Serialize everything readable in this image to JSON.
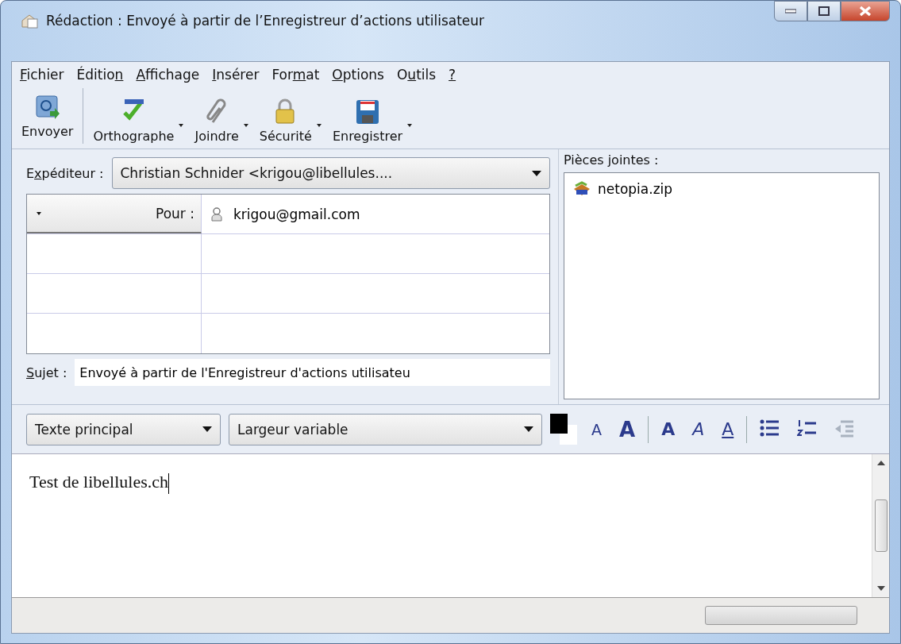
{
  "window": {
    "title": "Rédaction : Envoyé à partir de l’Enregistreur d’actions utilisateur"
  },
  "menu": [
    {
      "label": [
        {
          "text": "F",
          "underline": true
        },
        {
          "text": "ichier",
          "underline": false
        }
      ]
    },
    {
      "label": [
        {
          "text": "Éditio",
          "underline": false
        },
        {
          "text": "n",
          "underline": true
        }
      ]
    },
    {
      "label": [
        {
          "text": "A",
          "underline": true
        },
        {
          "text": "ffichage",
          "underline": false
        }
      ]
    },
    {
      "label": [
        {
          "text": "I",
          "underline": true
        },
        {
          "text": "nsérer",
          "underline": false
        }
      ]
    },
    {
      "label": [
        {
          "text": "For",
          "underline": false
        },
        {
          "text": "m",
          "underline": true
        },
        {
          "text": "at",
          "underline": false
        }
      ]
    },
    {
      "label": [
        {
          "text": "O",
          "underline": true
        },
        {
          "text": "ptions",
          "underline": false
        }
      ]
    },
    {
      "label": [
        {
          "text": "O",
          "underline": false
        },
        {
          "text": "u",
          "underline": true
        },
        {
          "text": "tils",
          "underline": false
        }
      ]
    },
    {
      "label": [
        {
          "text": "?",
          "underline": true
        }
      ]
    }
  ],
  "toolbar": [
    {
      "kind": "send",
      "label": "Envoyer",
      "dropdown": false
    },
    {
      "kind": "spell",
      "label": "Orthographe",
      "dropdown": true
    },
    {
      "kind": "attach",
      "label": "Joindre",
      "dropdown": true
    },
    {
      "kind": "security",
      "label": "Sécurité",
      "dropdown": true
    },
    {
      "kind": "save",
      "label": "Enregistrer",
      "dropdown": true
    }
  ],
  "sender": {
    "label": [
      {
        "text": "E",
        "underline": false
      },
      {
        "text": "x",
        "underline": true
      },
      {
        "text": "péditeur :",
        "underline": false
      }
    ],
    "value": "Christian Schnider <krigou@libellules...."
  },
  "recipients": [
    {
      "type": "Pour :",
      "address": "krigou@gmail.com"
    }
  ],
  "subject": {
    "label": [
      {
        "text": "S",
        "underline": true
      },
      {
        "text": "ujet :",
        "underline": false
      }
    ],
    "value": "Envoyé à partir de l'Enregistreur d'actions utilisateu"
  },
  "attachments": {
    "label": "Pièces jointes :",
    "items": [
      "netopia.zip"
    ]
  },
  "format": {
    "paragraph": "Texte principal",
    "font": "Largeur variable",
    "glyphs": [
      {
        "kind": "smaller",
        "text": "A"
      },
      {
        "kind": "larger",
        "text": "A"
      },
      {
        "kind": "bold",
        "text": "A"
      },
      {
        "kind": "italic",
        "text": "A"
      },
      {
        "kind": "underline",
        "text": "A"
      }
    ],
    "lists": [
      {
        "kind": "bullets"
      },
      {
        "kind": "numbers"
      },
      {
        "kind": "outdent",
        "disabled": true
      }
    ]
  },
  "body": {
    "text": "Test de libellules.ch"
  }
}
